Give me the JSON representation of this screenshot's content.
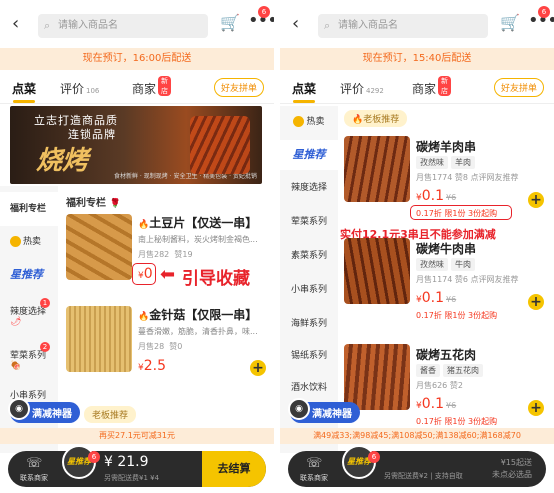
{
  "left": {
    "search_placeholder": "请输入商品名",
    "cart_badge": "6",
    "notice": "现在预订，16:00后配送",
    "tabs": [
      {
        "label": "点菜"
      },
      {
        "label": "评价",
        "count": "106"
      },
      {
        "label": "商家",
        "badge": "新店"
      }
    ],
    "friend_btn": "好友拼单",
    "banner": {
      "line1": "立志打造商品质",
      "line2": "连锁品牌",
      "line3": "烧烤",
      "line4": "食材新鲜 · 现制现烤 · 安全卫生 · 精美包装 · 贵妃批销"
    },
    "sidebar": [
      {
        "label": "福利专栏"
      },
      {
        "label": "热卖"
      },
      {
        "label": "星推荐"
      },
      {
        "label": "辣度选择",
        "badge": "1"
      },
      {
        "label": "荤菜系列",
        "badge": "2"
      },
      {
        "label": "小串系列"
      }
    ],
    "section": "福利专栏",
    "products": [
      {
        "name": "土豆片【仅送一串】",
        "desc": "南上秘制酱料，炭火烤制金褐色...",
        "sale": "月售282",
        "likes": "赞19",
        "price": "0",
        "currency": "¥"
      },
      {
        "name": "金针菇【仅限一串】",
        "desc": "蔓香滑嫩，筋脆，清香扑鼻，味...",
        "sale": "月售28",
        "likes": "赞0",
        "price": "2.5",
        "currency": "¥"
      }
    ],
    "annotation": "引导收藏",
    "mj_label": "满减神器",
    "boss_label": "老板推荐",
    "promo": "再买27.1元可减31元",
    "bar": {
      "service": "联系商家",
      "logo": "星推荐",
      "badge": "6",
      "amount": "¥ 21.9",
      "sub": "另需配送费¥1 ¥4",
      "checkout": "去结算"
    }
  },
  "right": {
    "search_placeholder": "请输入商品名",
    "cart_badge": "6",
    "notice": "现在预订，15:40后配送",
    "tabs": [
      {
        "label": "点菜"
      },
      {
        "label": "评价",
        "count": "4292"
      },
      {
        "label": "商家",
        "badge": "新店"
      }
    ],
    "friend_btn": "好友拼单",
    "sidebar": [
      {
        "label": "热卖"
      },
      {
        "label": "星推荐"
      },
      {
        "label": "辣度选择"
      },
      {
        "label": "荤菜系列"
      },
      {
        "label": "素菜系列"
      },
      {
        "label": "小串系列"
      },
      {
        "label": "海鲜系列"
      },
      {
        "label": "锡纸系列"
      },
      {
        "label": "酒水饮料"
      }
    ],
    "boss_label": "老板推荐",
    "products": [
      {
        "name": "碳烤羊肉串",
        "tags": [
          "孜然味",
          "羊肉"
        ],
        "sale": "月售1774",
        "likes": "赞8",
        "extra": "点评网友推荐",
        "price": "0.1",
        "old": "¥6",
        "limit": "0.17折 限1份 3份起购"
      },
      {
        "name": "碳烤牛肉串",
        "tags": [
          "孜然味",
          "牛肉"
        ],
        "sale": "月售1174",
        "likes": "赞6",
        "extra": "点评网友推荐",
        "price": "0.1",
        "old": "¥6",
        "limit": "0.17折 限1份 3份起购"
      },
      {
        "name": "碳烤五花肉",
        "tags": [
          "酱香",
          "猪五花肉"
        ],
        "sale": "月售626",
        "likes": "赞2",
        "price": "0.1",
        "old": "¥6",
        "limit": "0.17折 限1份 3份起购"
      }
    ],
    "annotation": "实付12.1元3串且不能参加满减",
    "mj_label": "满减神器",
    "promo": "满49减33;满98减45;满108减50;满138减60;满168减70",
    "bar": {
      "service": "联系商家",
      "logo": "星推荐",
      "badge": "6",
      "sub": "另需配送费¥2 | 支持自取",
      "min": "¥15起送",
      "min2": "未点必选品"
    }
  }
}
